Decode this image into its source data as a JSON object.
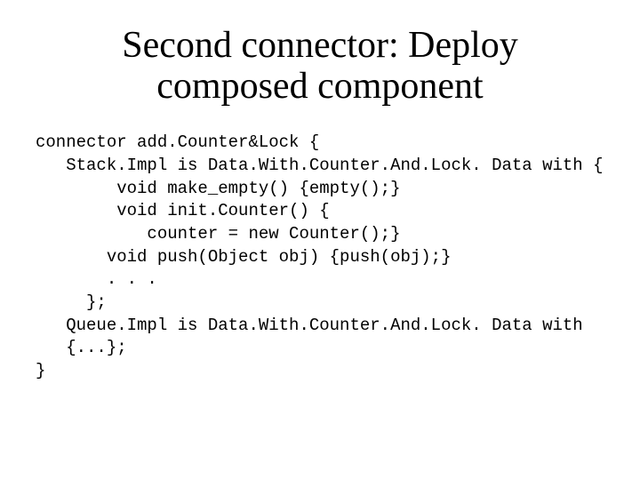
{
  "title_line1": "Second connector: Deploy",
  "title_line2": "composed component",
  "code": {
    "l1": "connector add.Counter&Lock {",
    "l2": "   Stack.Impl is Data.With.Counter.And.Lock. Data with {",
    "l3": "        void make_empty() {empty();}",
    "l4": "        void init.Counter() {",
    "l5": "           counter = new Counter();}",
    "l6": "       void push(Object obj) {push(obj);}",
    "l7": "       . . .",
    "l8": "     };",
    "l9": "   Queue.Impl is Data.With.Counter.And.Lock. Data with",
    "l10": "   {...};",
    "l11": "}"
  }
}
